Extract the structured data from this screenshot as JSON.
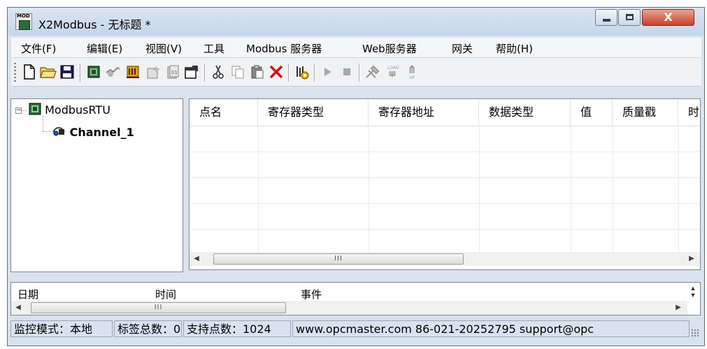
{
  "window": {
    "title": "X2Modbus - 无标题 *",
    "icon_text": "MOD",
    "close_glyph": "X"
  },
  "menu": [
    "文件(F)",
    "编辑(E)",
    "视图(V)",
    "工具",
    "Modbus 服务器",
    "Web服务器",
    "网关",
    "帮助(H)"
  ],
  "toolbar": {
    "icons": [
      "new-file-icon",
      "open-folder-icon",
      "save-icon",
      "add-device-icon",
      "add-channel-icon",
      "add-tag-icon",
      "new-group-icon",
      "add-point-icon",
      "properties-icon",
      "cut-icon",
      "copy-icon",
      "paste-icon",
      "delete-icon",
      "run-config-icon",
      "play-icon",
      "stop-icon",
      "tools-icon",
      "load-icon",
      "upload-icon"
    ],
    "load_label": "LOAD",
    "up_label": "UP"
  },
  "tree": {
    "root": "ModbusRTU",
    "expander": "−",
    "child": "Channel_1"
  },
  "grid": {
    "columns": [
      "点名",
      "寄存器类型",
      "寄存器地址",
      "数据类型",
      "值",
      "质量戳",
      "时间"
    ],
    "rows": []
  },
  "log": {
    "columns": [
      "日期",
      "时间",
      "事件"
    ]
  },
  "scroll": {
    "thumb_grip": "III",
    "left_arrow": "◀",
    "right_arrow": "▶",
    "up_arrow": "▲",
    "down_arrow": "▼"
  },
  "status": {
    "mode": "监控模式：本地",
    "tag_count": "标签总数：0",
    "support_points": "支持点数：1024",
    "contact": "www.opcmaster.com 86-021-20252795 support@opc"
  }
}
